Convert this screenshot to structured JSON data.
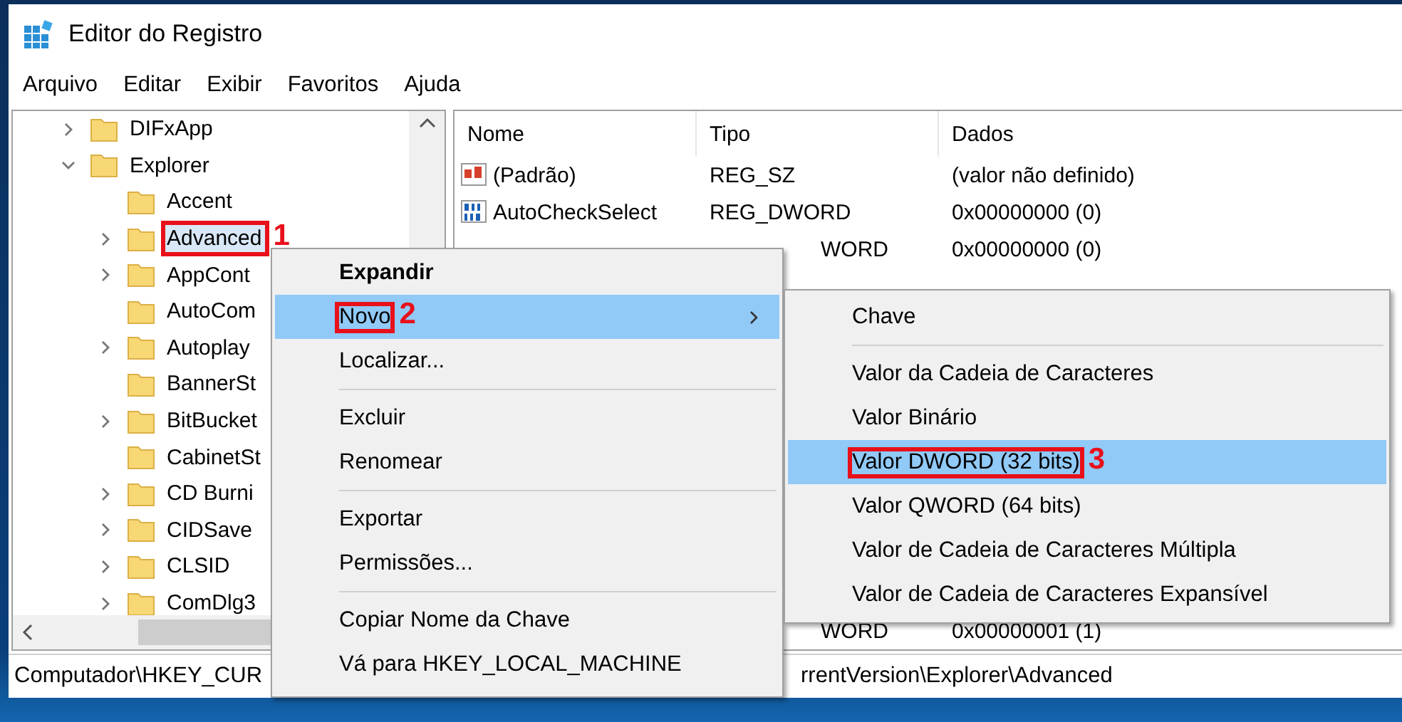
{
  "window": {
    "title": "Editor do Registro"
  },
  "menu_bar": [
    "Arquivo",
    "Editar",
    "Exibir",
    "Favoritos",
    "Ajuda"
  ],
  "tree": [
    {
      "label": "DIFxApp",
      "expandable": true,
      "expanded": false,
      "selected": false
    },
    {
      "label": "Explorer",
      "expandable": true,
      "expanded": true,
      "selected": false,
      "children": [
        {
          "label": "Accent",
          "expandable": false,
          "selected": false
        },
        {
          "label": "Advanced",
          "expandable": true,
          "expanded": false,
          "selected": true,
          "callout": "1"
        },
        {
          "label": "AppCont",
          "expandable": true,
          "expanded": false,
          "selected": false
        },
        {
          "label": "AutoCom",
          "expandable": false,
          "selected": false
        },
        {
          "label": "Autoplay",
          "expandable": true,
          "expanded": false,
          "selected": false
        },
        {
          "label": "BannerSt",
          "expandable": false,
          "selected": false
        },
        {
          "label": "BitBucket",
          "expandable": true,
          "expanded": false,
          "selected": false
        },
        {
          "label": "CabinetSt",
          "expandable": false,
          "selected": false
        },
        {
          "label": "CD Burni",
          "expandable": true,
          "expanded": false,
          "selected": false
        },
        {
          "label": "CIDSave",
          "expandable": true,
          "expanded": false,
          "selected": false
        },
        {
          "label": "CLSID",
          "expandable": true,
          "expanded": false,
          "selected": false
        },
        {
          "label": "ComDlg3",
          "expandable": true,
          "expanded": false,
          "selected": false
        }
      ]
    }
  ],
  "list": {
    "columns": [
      "Nome",
      "Tipo",
      "Dados"
    ],
    "rows": [
      {
        "kind": "string",
        "name": "(Padrão)",
        "type": "REG_SZ",
        "data": "(valor não definido)"
      },
      {
        "kind": "binary",
        "name": "AutoCheckSelect",
        "type": "REG_DWORD",
        "data": "0x00000000 (0)"
      },
      {
        "kind": "partial",
        "type": "WORD",
        "data": "0x00000000 (0)"
      }
    ],
    "bottom_row": {
      "kind": "partial",
      "type": "WORD",
      "data": "0x00000001 (1)"
    }
  },
  "status_bar": {
    "left": "Computador\\HKEY_CUR",
    "right": "rrentVersion\\Explorer\\Advanced"
  },
  "context_menu": {
    "items": [
      {
        "kind": "item",
        "label": "Expandir",
        "bold": true,
        "selected": false,
        "submenu": false
      },
      {
        "kind": "item",
        "label": "Novo",
        "bold": false,
        "selected": true,
        "submenu": true,
        "callout": "2"
      },
      {
        "kind": "item",
        "label": "Localizar...",
        "bold": false,
        "selected": false,
        "submenu": false
      },
      {
        "kind": "separator"
      },
      {
        "kind": "item",
        "label": "Excluir",
        "bold": false,
        "selected": false,
        "submenu": false
      },
      {
        "kind": "item",
        "label": "Renomear",
        "bold": false,
        "selected": false,
        "submenu": false
      },
      {
        "kind": "separator"
      },
      {
        "kind": "item",
        "label": "Exportar",
        "bold": false,
        "selected": false,
        "submenu": false
      },
      {
        "kind": "item",
        "label": "Permissões...",
        "bold": false,
        "selected": false,
        "submenu": false
      },
      {
        "kind": "separator"
      },
      {
        "kind": "item",
        "label": "Copiar Nome da Chave",
        "bold": false,
        "selected": false,
        "submenu": false
      },
      {
        "kind": "item",
        "label": "Vá para HKEY_LOCAL_MACHINE",
        "bold": false,
        "selected": false,
        "submenu": false
      }
    ]
  },
  "submenu": {
    "items": [
      {
        "kind": "item",
        "label": "Chave",
        "selected": false
      },
      {
        "kind": "separator"
      },
      {
        "kind": "item",
        "label": "Valor da Cadeia de Caracteres",
        "selected": false
      },
      {
        "kind": "item",
        "label": "Valor Binário",
        "selected": false
      },
      {
        "kind": "item",
        "label": "Valor DWORD (32 bits)",
        "selected": true,
        "callout": "3"
      },
      {
        "kind": "item",
        "label": "Valor QWORD (64 bits)",
        "selected": false
      },
      {
        "kind": "item",
        "label": "Valor de Cadeia de Caracteres Múltipla",
        "selected": false
      },
      {
        "kind": "item",
        "label": "Valor de Cadeia de Caracteres Expansível",
        "selected": false
      }
    ]
  }
}
